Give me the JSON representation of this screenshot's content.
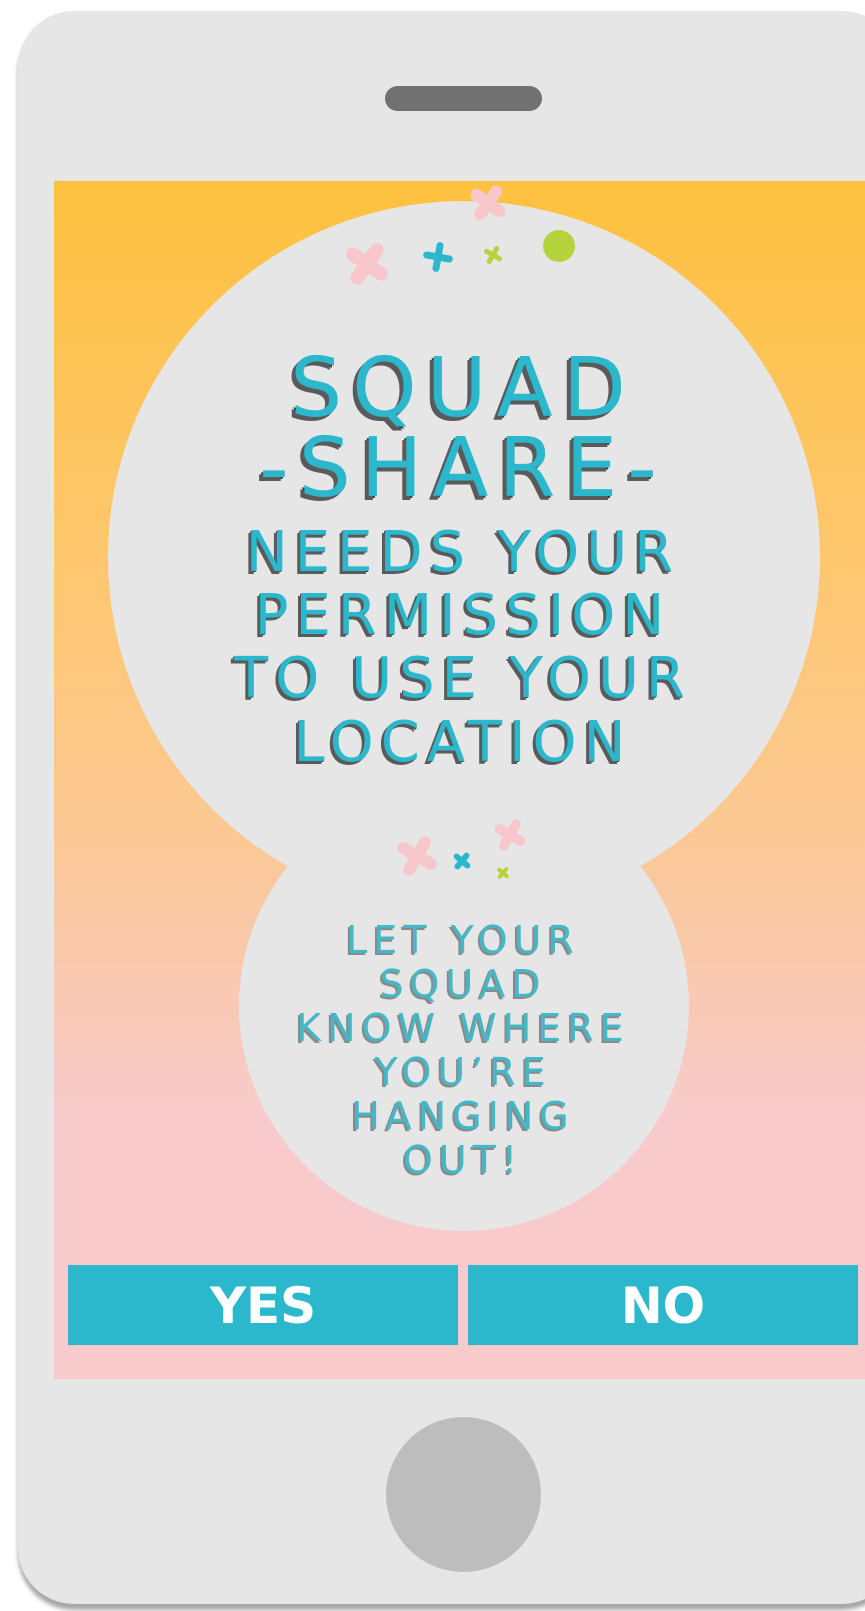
{
  "app": {
    "title_line_1": "SQUAD",
    "title_line_2": "-SHARE-"
  },
  "permission": {
    "line_1": "NEEDS YOUR",
    "line_2": "PERMISSION",
    "line_3": "TO USE YOUR",
    "line_4": "LOCATION"
  },
  "tagline": {
    "line_1": "LET YOUR",
    "line_2": "SQUAD",
    "line_3": "KNOW WHERE",
    "line_4": "YOU’RE",
    "line_5": "HANGING",
    "line_6": "OUT!"
  },
  "actions": {
    "yes_label": "YES",
    "no_label": "NO"
  },
  "colors": {
    "accent": "#2bb7cc",
    "blob": "#e6e6e6",
    "pink": "#f8c7cb",
    "green": "#b5d33b",
    "phone_body": "#e6e6e6"
  }
}
